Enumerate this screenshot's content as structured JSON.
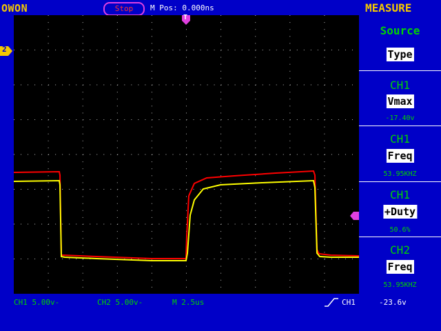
{
  "brand": "OWON",
  "header": {
    "status": "Stop",
    "mpos": "M Pos: 0.000ns"
  },
  "panel": {
    "title": "MEASURE",
    "source_label": "Source",
    "type_label": "Type",
    "measurements": [
      {
        "channel": "CH1",
        "type": "Vmax",
        "value": "-17.40v"
      },
      {
        "channel": "CH1",
        "type": "Freq",
        "value": "53.95KHZ"
      },
      {
        "channel": "CH1",
        "type": "+Duty",
        "value": "50.6%"
      },
      {
        "channel": "CH2",
        "type": "Freq",
        "value": "53.95KHZ"
      }
    ]
  },
  "footer": {
    "ch1_scale": "CH1  5.00v-",
    "ch2_scale": "CH2  5.00v-",
    "timebase": "M 2.5us",
    "trigger_source": "CH1",
    "trigger_level": "-23.6v"
  },
  "markers": {
    "trigger_pos": "T",
    "ch2_offset": "2"
  },
  "colors": {
    "ch1": "#ffff00",
    "ch2": "#ff0000",
    "grid": "#ffffff",
    "accent": "#00d400"
  }
}
